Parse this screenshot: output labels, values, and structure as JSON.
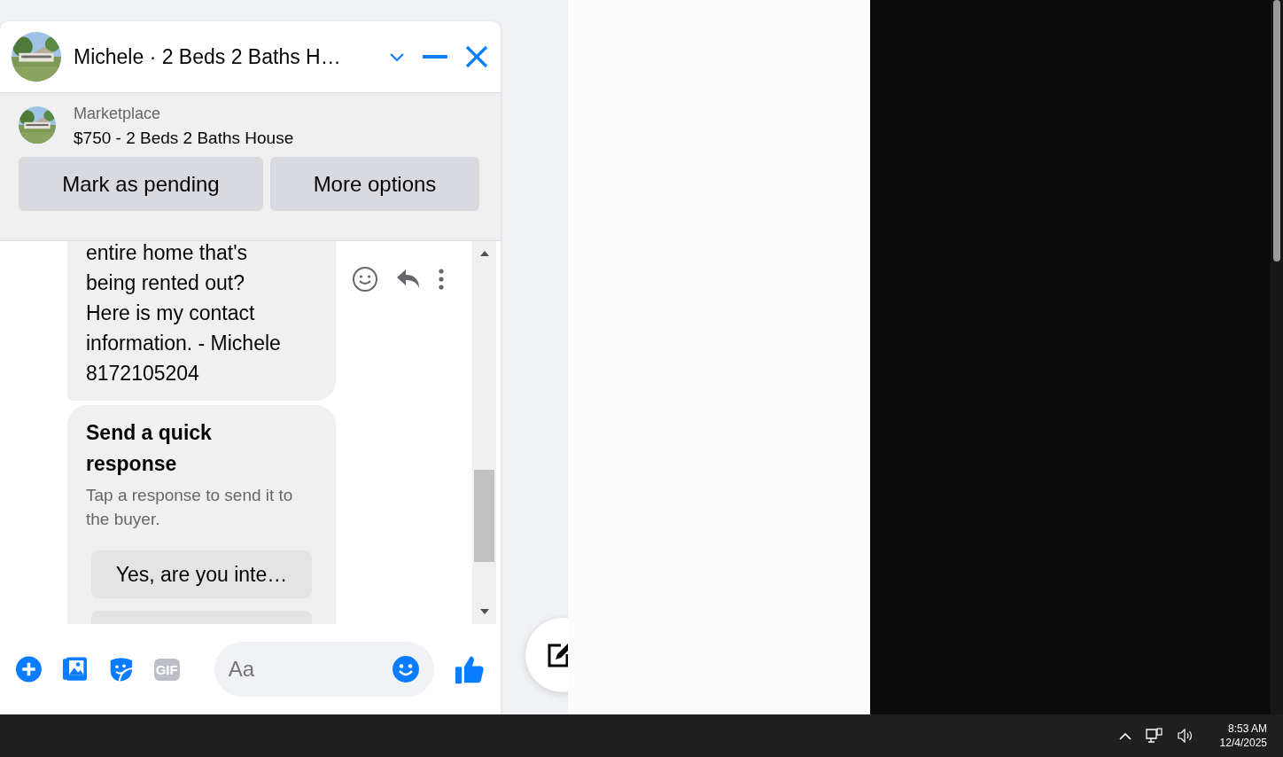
{
  "chat": {
    "title": "Michele · 2 Beds 2 Baths H…",
    "listing": {
      "source": "Marketplace",
      "title": "$750 - 2 Beds 2 Baths House"
    },
    "actions": [
      "Mark as pending",
      "More options"
    ],
    "messages": [
      {
        "kind": "text",
        "text": "entire home that's being rented out? Here is my contact information. - Michele 8172105204"
      },
      {
        "kind": "quick_responses",
        "title": "Send a quick response",
        "subtitle": "Tap a response to send it to the buyer.",
        "responses": [
          "Yes, are you inte…"
        ]
      }
    ],
    "composer": {
      "placeholder": "Aa",
      "gif": "GIF"
    }
  },
  "taskbar": {
    "time": "8:53 AM",
    "date": "12/4/2025"
  }
}
